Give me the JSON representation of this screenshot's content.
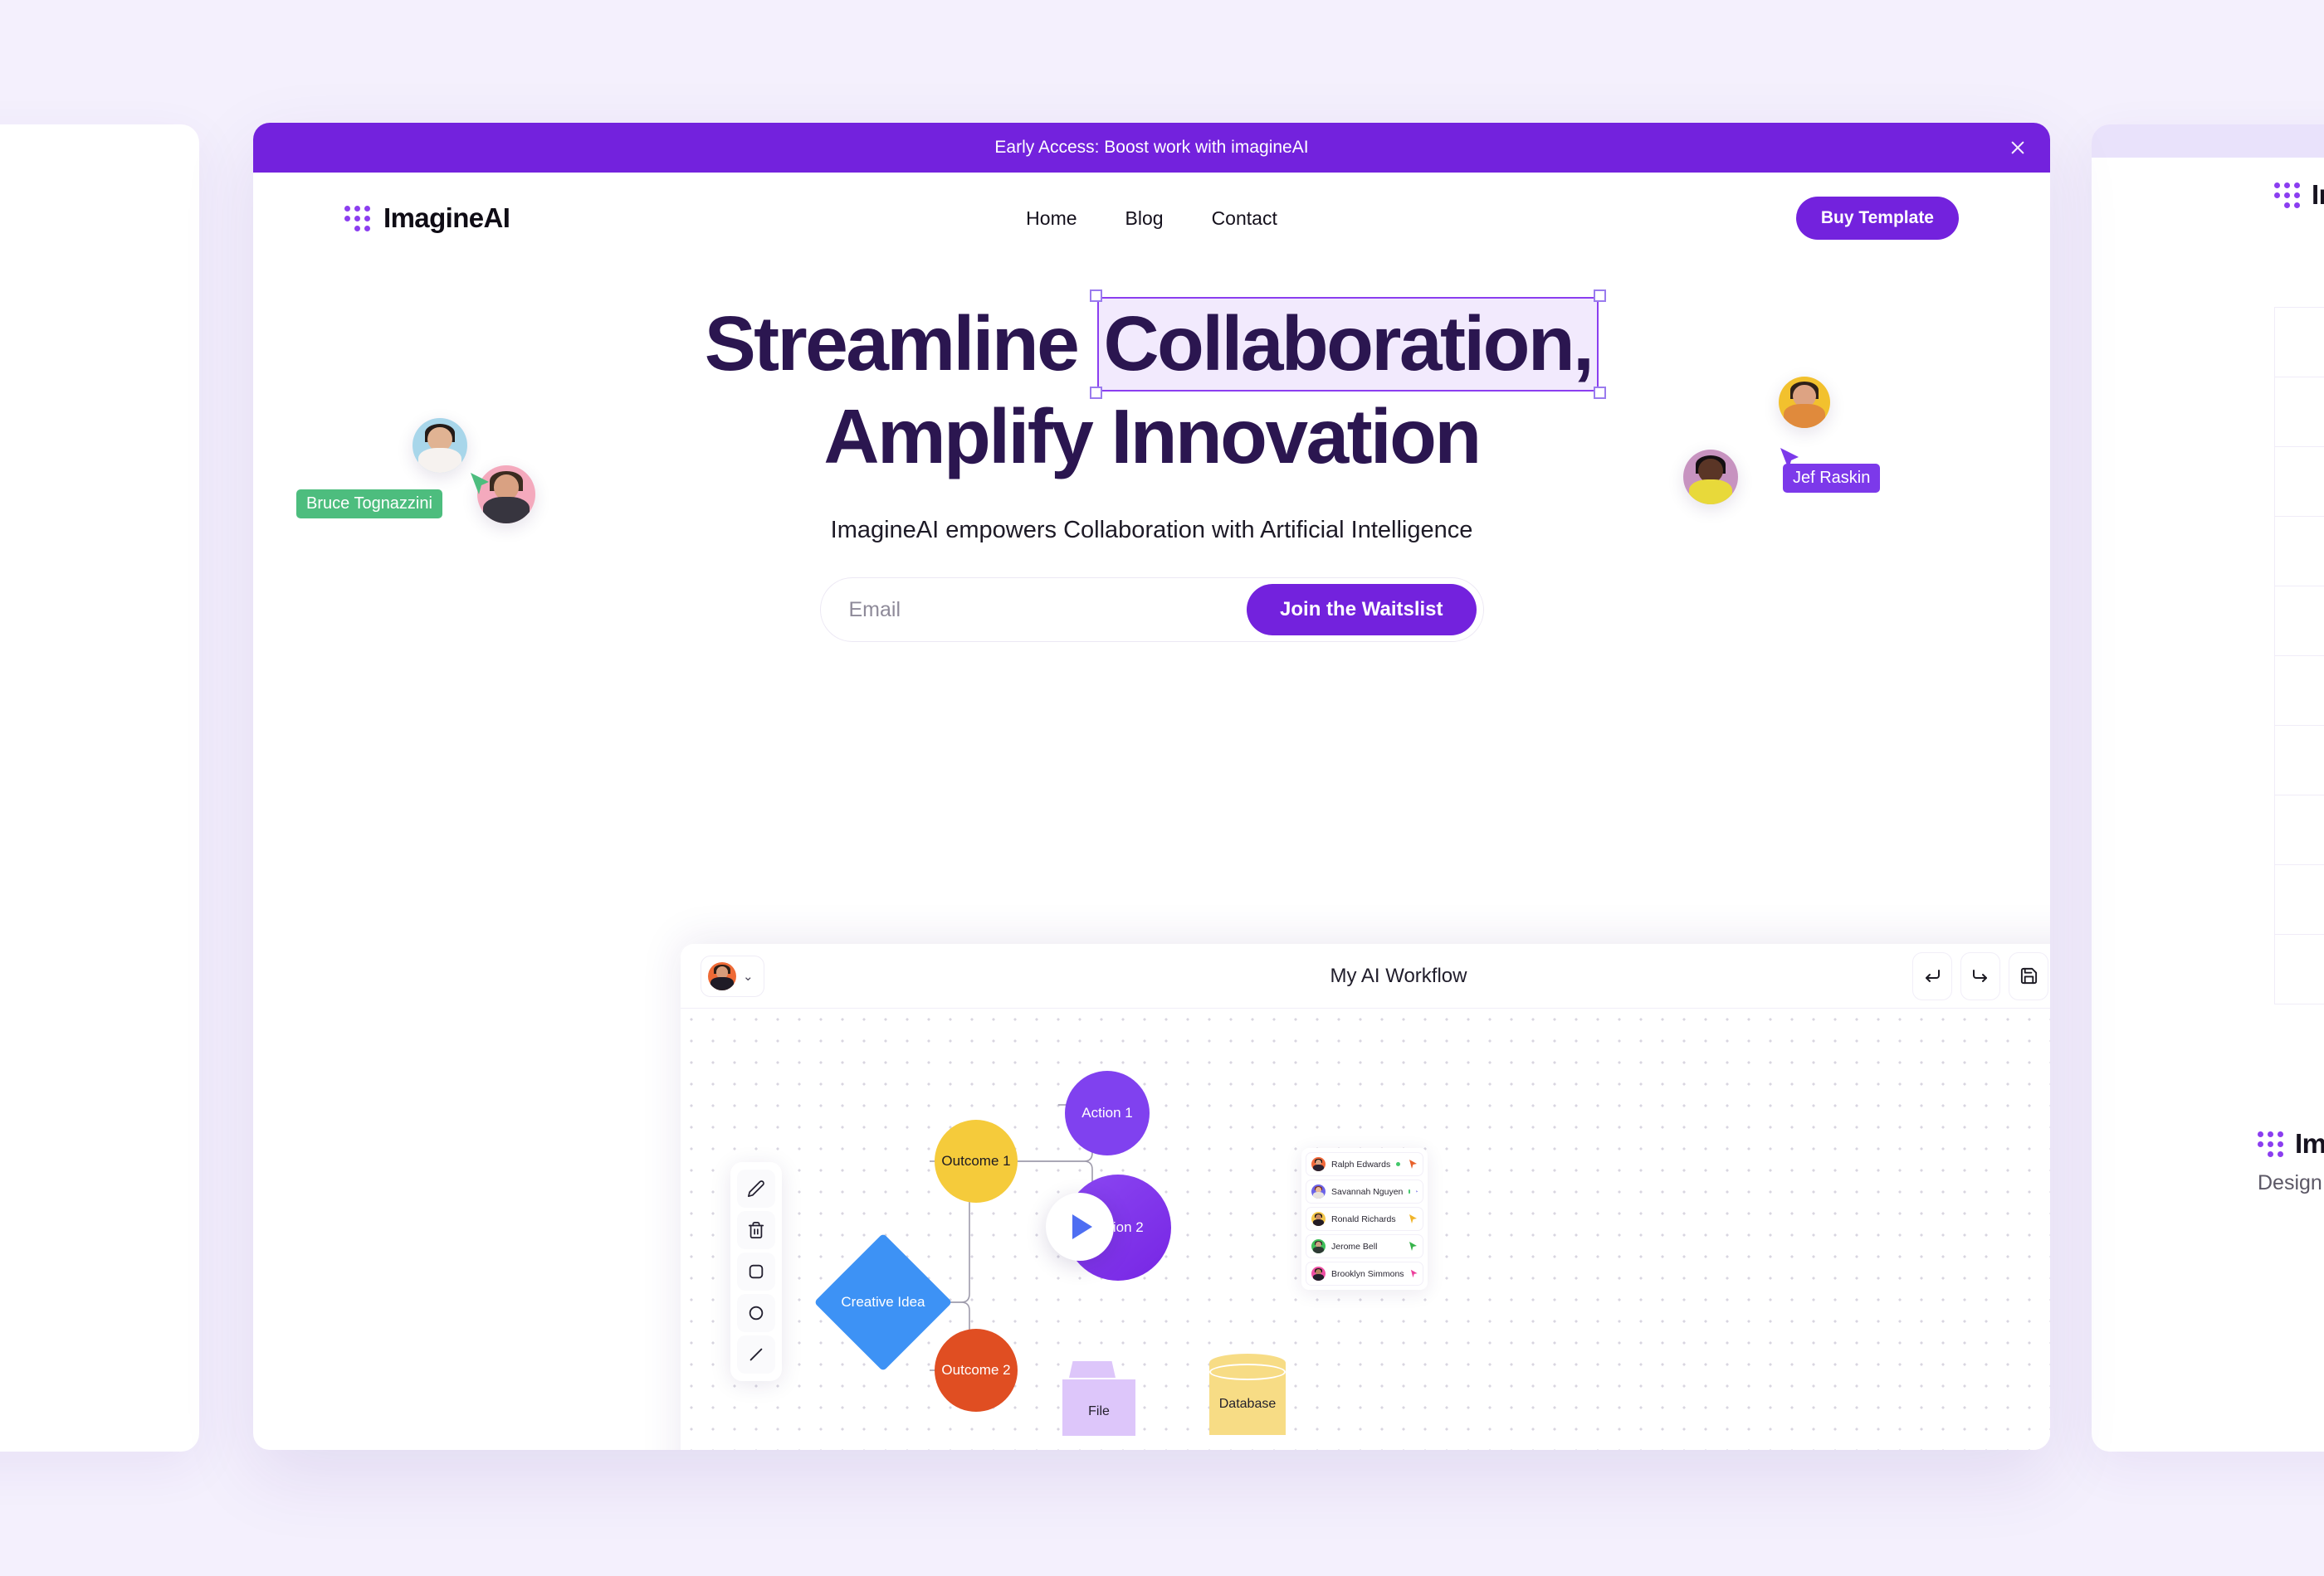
{
  "banner": {
    "text": "Early Access: Boost work with imagineAI",
    "close_label": "×",
    "bg": "#7322dd"
  },
  "nav": {
    "brand": "ImagineAI",
    "links": [
      {
        "label": "Home"
      },
      {
        "label": "Blog"
      },
      {
        "label": "Contact"
      }
    ],
    "cta": "Buy Template"
  },
  "hero": {
    "headline_part1": "Streamline ",
    "headline_selected": "Collaboration,",
    "headline_line2": "Amplify Innovation",
    "subheadline": "ImagineAI empowers Collaboration with Artificial Intelligence",
    "email_placeholder": "Email",
    "email_value": "",
    "submit_label": "Join the Waitslist"
  },
  "collaborators": [
    {
      "name": "Bruce Tognazzini",
      "color": "#4dbd7e",
      "side": "left"
    },
    {
      "name": "Jef Raskin",
      "color": "#7c39ea",
      "side": "right"
    }
  ],
  "workflow": {
    "title": "My AI Workflow",
    "user_chevron": "⌄",
    "actions": [
      {
        "name": "undo-button",
        "glyph": "↵"
      },
      {
        "name": "redo-button",
        "glyph": "↳"
      },
      {
        "name": "save-button",
        "glyph": "save-icon"
      },
      {
        "name": "share-button",
        "glyph": "share-icon"
      }
    ],
    "tools": [
      {
        "name": "pencil-tool",
        "icon": "pencil-icon"
      },
      {
        "name": "delete-tool",
        "icon": "trash-icon"
      },
      {
        "name": "square-tool",
        "icon": "square-icon"
      },
      {
        "name": "circle-tool",
        "icon": "circle-icon"
      },
      {
        "name": "line-tool",
        "icon": "line-icon"
      }
    ],
    "nodes": {
      "idea": {
        "label": "Creative Idea",
        "color": "#3d92f5"
      },
      "outcome1": {
        "label": "Outcome 1",
        "color": "#f5cb3b"
      },
      "outcome2": {
        "label": "Outcome 2",
        "color": "#e04e22"
      },
      "action1": {
        "label": "Action 1",
        "color": "#8041ef"
      },
      "action2": {
        "label": "Action 2",
        "color": "#7725e4"
      },
      "file": {
        "label": "File",
        "color": "#ddc6fa"
      },
      "database": {
        "label": "Database",
        "color": "#f7dc85"
      }
    },
    "users": [
      {
        "name": "Ralph Edwards",
        "cursor": "#e8622c",
        "online": true,
        "avatar_bg": "#f26a3c"
      },
      {
        "name": "Savannah Nguyen",
        "cursor": "#4b46e0",
        "online": true,
        "avatar_bg": "#6c63e8"
      },
      {
        "name": "Ronald Richards",
        "cursor": "#f0b429",
        "online": false,
        "avatar_bg": "#f3c64a"
      },
      {
        "name": "Jerome Bell",
        "cursor": "#37b34a",
        "online": false,
        "avatar_bg": "#3fbf5a"
      },
      {
        "name": "Brooklyn Simmons",
        "cursor": "#ec3f9b",
        "online": false,
        "avatar_bg": "#ef4fa3"
      }
    ]
  },
  "side_card_right": {
    "footer_title": "Im",
    "footer_sub": "Design"
  },
  "theme": {
    "accent": "#7322dd",
    "heading": "#2b1650",
    "page_bg": "#f4f0fd"
  }
}
